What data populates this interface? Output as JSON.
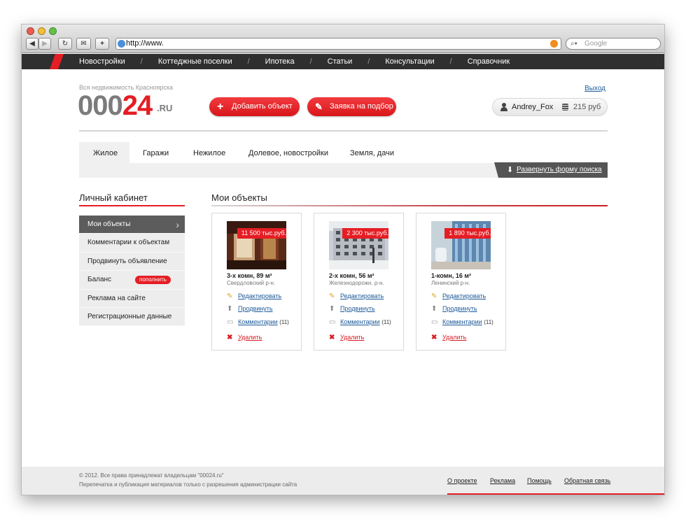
{
  "browser": {
    "url": "http://www.",
    "search_placeholder": "Google",
    "back_label": "◀",
    "forward_label": "▶",
    "reload_label": "↻",
    "bookmarks_label": "✉",
    "add_label": "+"
  },
  "topnav": {
    "items": [
      "Новостройки",
      "Коттеджные поселки",
      "Ипотека",
      "Статьи",
      "Консультации",
      "Справочник"
    ],
    "separator": "/"
  },
  "header": {
    "tagline": "Вся недвижимость Красноярска",
    "logo_gray": "000",
    "logo_red": "24",
    "logo_ru": ".RU",
    "logout": "Выход",
    "add_object": "Добавить объект",
    "request": "Заявка на подбор",
    "username": "Andrey_Fox",
    "balance": "215 руб"
  },
  "tabs": {
    "items": [
      "Жилое",
      "Гаражи",
      "Нежилое",
      "Долевое, новостройки",
      "Земля, дачи"
    ],
    "expand": "Развернуть форму поиска"
  },
  "sidebar": {
    "title": "Личный кабинет",
    "items": [
      "Мои объекты",
      "Комментарии к объектам",
      "Продвинуть объявление",
      "Баланс",
      "Реклама на сайте",
      "Регистрационные данные"
    ],
    "badge": "пополнить"
  },
  "main": {
    "title": "Мои объекты",
    "actions": {
      "edit": "Редактировать",
      "promote": "Продвинуть",
      "comments": "Комментарии",
      "delete": "Удалить"
    },
    "cards": [
      {
        "price": "11 500 тыс.руб.",
        "title": "3-х комн, 89 м²",
        "district": "Свердловский р-н.",
        "comments_count": "(11)"
      },
      {
        "price": "2 300 тыс.руб.",
        "title": "2-х комн, 56 м²",
        "district": "Железнодорожн. р-н.",
        "comments_count": "(11)"
      },
      {
        "price": "1 890 тыс.руб.",
        "title": "1-комн, 16 м²",
        "district": "Ленинский р-н.",
        "comments_count": "(11)"
      }
    ]
  },
  "footer": {
    "copyright": "© 2012. Все права принадлежат владельцам \"00024.ru\"",
    "reprint": "Перепечатка и публикация материалов только с разрешения администрации сайта",
    "links": [
      "О проекте",
      "Реклама",
      "Помощь",
      "Обратная связь"
    ]
  },
  "colors": {
    "brand_red": "#e51d24",
    "nav_dark": "#2f2f2f",
    "link_blue": "#1d5a99"
  }
}
